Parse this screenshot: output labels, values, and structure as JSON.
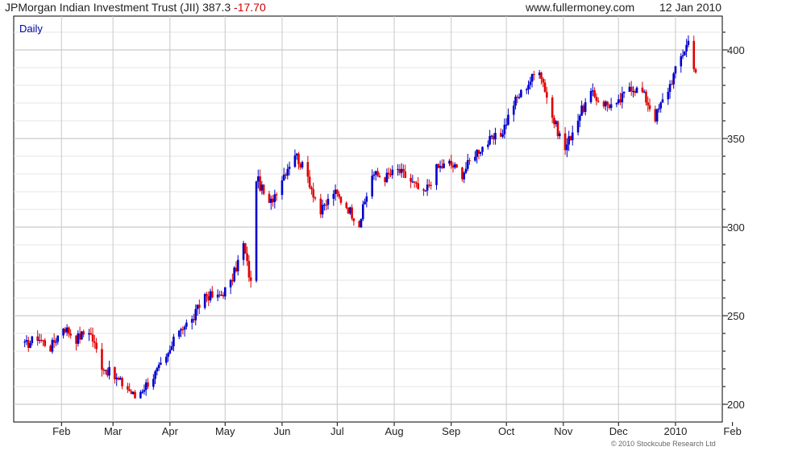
{
  "header": {
    "title": "JPMorgan Indian Investment Trust (JII)",
    "last": "387.3",
    "change": "-17.70",
    "site": "www.fullermoney.com",
    "date": "12 Jan 2010"
  },
  "copyright": "© 2010 Stockcube Research Ltd",
  "colors": {
    "up": "#0000cc",
    "down": "#e00000",
    "grid": "#c8c8c8",
    "axis": "#000000",
    "label_blue": "#0000aa"
  },
  "chart_data": {
    "type": "ohlc",
    "period_label": "Daily",
    "y_ticks": [
      200,
      250,
      300,
      350,
      400
    ],
    "ylim": [
      190,
      410
    ],
    "x_ticks": [
      "Feb",
      "Mar",
      "Apr",
      "May",
      "Jun",
      "Jul",
      "Aug",
      "Sep",
      "Oct",
      "Nov",
      "Dec",
      "2010",
      "Feb"
    ],
    "grid": true,
    "series": [
      {
        "values": [
          {
            "date": "2009-01-12",
            "close": 233
          },
          {
            "date": "2009-01-19",
            "close": 238
          },
          {
            "date": "2009-01-26",
            "close": 232
          },
          {
            "date": "2009-02-02",
            "close": 244
          },
          {
            "date": "2009-02-09",
            "close": 237
          },
          {
            "date": "2009-02-16",
            "close": 242
          },
          {
            "date": "2009-02-23",
            "close": 222
          },
          {
            "date": "2009-03-02",
            "close": 215
          },
          {
            "date": "2009-03-09",
            "close": 209
          },
          {
            "date": "2009-03-13",
            "close": 204
          },
          {
            "date": "2009-03-23",
            "close": 216
          },
          {
            "date": "2009-03-30",
            "close": 225
          },
          {
            "date": "2009-04-06",
            "close": 243
          },
          {
            "date": "2009-04-13",
            "close": 247
          },
          {
            "date": "2009-04-20",
            "close": 262
          },
          {
            "date": "2009-04-27",
            "close": 260
          },
          {
            "date": "2009-05-04",
            "close": 268
          },
          {
            "date": "2009-05-11",
            "close": 290
          },
          {
            "date": "2009-05-15",
            "close": 268
          },
          {
            "date": "2009-05-18",
            "close": 328
          },
          {
            "date": "2009-05-25",
            "close": 312
          },
          {
            "date": "2009-06-01",
            "close": 328
          },
          {
            "date": "2009-06-08",
            "close": 342
          },
          {
            "date": "2009-06-15",
            "close": 328
          },
          {
            "date": "2009-06-22",
            "close": 308
          },
          {
            "date": "2009-06-29",
            "close": 320
          },
          {
            "date": "2009-07-06",
            "close": 312
          },
          {
            "date": "2009-07-13",
            "close": 302
          },
          {
            "date": "2009-07-20",
            "close": 330
          },
          {
            "date": "2009-07-27",
            "close": 328
          },
          {
            "date": "2009-08-03",
            "close": 332
          },
          {
            "date": "2009-08-10",
            "close": 326
          },
          {
            "date": "2009-08-17",
            "close": 318
          },
          {
            "date": "2009-08-24",
            "close": 333
          },
          {
            "date": "2009-08-31",
            "close": 336
          },
          {
            "date": "2009-09-07",
            "close": 330
          },
          {
            "date": "2009-09-14",
            "close": 342
          },
          {
            "date": "2009-09-21",
            "close": 348
          },
          {
            "date": "2009-09-28",
            "close": 352
          },
          {
            "date": "2009-10-05",
            "close": 370
          },
          {
            "date": "2009-10-12",
            "close": 380
          },
          {
            "date": "2009-10-19",
            "close": 390
          },
          {
            "date": "2009-10-26",
            "close": 362
          },
          {
            "date": "2009-11-02",
            "close": 344
          },
          {
            "date": "2009-11-09",
            "close": 362
          },
          {
            "date": "2009-11-16",
            "close": 375
          },
          {
            "date": "2009-11-23",
            "close": 370
          },
          {
            "date": "2009-11-30",
            "close": 368
          },
          {
            "date": "2009-12-07",
            "close": 380
          },
          {
            "date": "2009-12-14",
            "close": 376
          },
          {
            "date": "2009-12-21",
            "close": 362
          },
          {
            "date": "2009-12-28",
            "close": 378
          },
          {
            "date": "2010-01-04",
            "close": 396
          },
          {
            "date": "2010-01-08",
            "close": 405
          },
          {
            "date": "2010-01-12",
            "close": 387.3
          }
        ]
      }
    ]
  }
}
